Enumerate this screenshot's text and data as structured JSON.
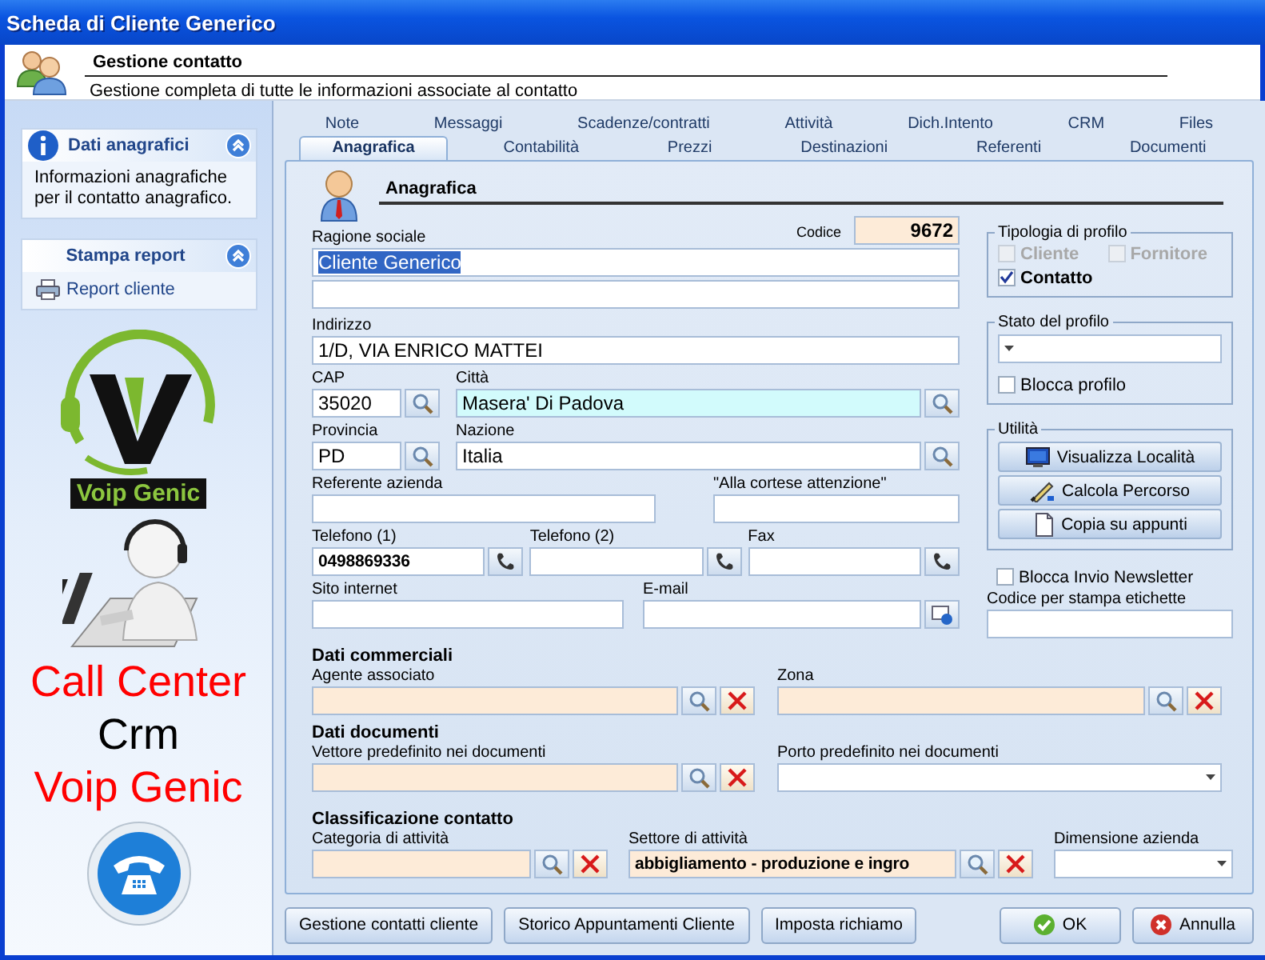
{
  "window": {
    "title": "Scheda di Cliente Generico"
  },
  "header": {
    "title": "Gestione contatto",
    "subtitle": "Gestione completa di tutte le informazioni associate al contatto"
  },
  "sidebar": {
    "panels": [
      {
        "kind": "info",
        "title": "Dati anagrafici",
        "expanded": true,
        "text": "Informazioni anagrafiche per il contatto anagrafico."
      },
      {
        "kind": "links",
        "title": "Stampa report",
        "expanded": true,
        "links": [
          "Report cliente"
        ]
      }
    ],
    "logo_caption": "Voip Genic",
    "promo_lines": [
      {
        "text": "Call Center",
        "color": "#ff0000"
      },
      {
        "text": "Crm",
        "color": "#000000"
      },
      {
        "text": "Voip Genic",
        "color": "#ff0000"
      }
    ]
  },
  "tabs": [
    [
      {
        "label": "Note",
        "selected": false
      },
      {
        "label": "Messaggi",
        "selected": false
      },
      {
        "label": "Scadenze/contratti",
        "selected": false
      },
      {
        "label": "Attività",
        "selected": false
      },
      {
        "label": "Dich.Intento",
        "selected": false
      },
      {
        "label": "CRM",
        "selected": false
      },
      {
        "label": "Files",
        "selected": false
      }
    ],
    [
      {
        "label": "Anagrafica",
        "selected": true
      },
      {
        "label": "Contabilità",
        "selected": false
      },
      {
        "label": "Prezzi",
        "selected": false
      },
      {
        "label": "Destinazioni",
        "selected": false
      },
      {
        "label": "Referenti",
        "selected": false
      },
      {
        "label": "Documenti",
        "selected": false
      }
    ]
  ],
  "section_title": "Anagrafica",
  "codice": {
    "label": "Codice",
    "value": "9672"
  },
  "ragione_sociale": {
    "label": "Ragione sociale",
    "value": "Cliente Generico",
    "value_selected": true
  },
  "rows": [
    [
      {
        "kind": "text",
        "label": "Indirizzo",
        "value": "1/D, VIA ENRICO MATTEI"
      }
    ],
    [
      {
        "kind": "lookup",
        "label": "CAP",
        "value": "35020"
      },
      {
        "kind": "lookup",
        "label": "Città",
        "value": "Masera' Di Padova",
        "focused": true
      }
    ],
    [
      {
        "kind": "lookup",
        "label": "Provincia",
        "value": "PD"
      },
      {
        "kind": "lookup",
        "label": "Nazione",
        "value": "Italia"
      }
    ],
    [
      {
        "kind": "text",
        "label": "Referente azienda"
      },
      {
        "kind": "text",
        "label": "\"Alla cortese attenzione\""
      }
    ],
    [
      {
        "kind": "dial",
        "label": "Telefono (1)",
        "value": "0498869336",
        "bold": true
      },
      {
        "kind": "dial",
        "label": "Telefono (2)"
      },
      {
        "kind": "dial",
        "label": "Fax"
      }
    ],
    [
      {
        "kind": "text",
        "label": "Sito internet"
      },
      {
        "kind": "mail",
        "label": "E-mail"
      }
    ]
  ],
  "profile_type": {
    "title": "Tipologia di profilo",
    "options": [
      {
        "label": "Cliente",
        "checked": false,
        "disabled": true
      },
      {
        "label": "Fornitore",
        "checked": false,
        "disabled": true
      },
      {
        "label": "Contatto",
        "checked": true,
        "disabled": false
      }
    ]
  },
  "profile_state": {
    "title": "Stato del profilo",
    "checkbox": {
      "label": "Blocca profilo",
      "checked": false
    }
  },
  "utilities": {
    "title": "Utilità",
    "buttons": [
      {
        "label": "Visualizza Località",
        "kind": "locate"
      },
      {
        "label": "Calcola Percorso",
        "kind": "route"
      },
      {
        "label": "Copia su appunti",
        "kind": "copy"
      }
    ]
  },
  "newsletter": {
    "label": "Blocca Invio Newsletter",
    "checked": false
  },
  "label_code": {
    "kind": "text",
    "label": "Codice per stampa etichette"
  },
  "sections": [
    {
      "title": "Dati commerciali",
      "fields": [
        {
          "kind": "lookup_clear",
          "label": "Agente associato",
          "readonly": true
        },
        {
          "kind": "lookup_clear",
          "label": "Zona",
          "readonly": true
        }
      ]
    },
    {
      "title": "Dati documenti",
      "fields": [
        {
          "kind": "lookup_clear",
          "label": "Vettore predefinito nei documenti",
          "readonly": true
        },
        {
          "kind": "dropdown",
          "label": "Porto predefinito nei documenti"
        }
      ]
    },
    {
      "title": "Classificazione contatto",
      "fields": [
        {
          "kind": "lookup_clear",
          "label": "Categoria di attività",
          "readonly": true
        },
        {
          "kind": "lookup_clear",
          "label": "Settore di attività",
          "value": "abbigliamento - produzione e ingro",
          "readonly": true,
          "bold": true
        },
        {
          "kind": "dropdown",
          "label": "Dimensione azienda"
        }
      ]
    }
  ],
  "footer": {
    "left": [
      {
        "label": "Gestione contatti cliente"
      },
      {
        "label": "Storico Appuntamenti Cliente"
      },
      {
        "label": "Imposta richiamo"
      }
    ],
    "right": [
      {
        "label": "OK",
        "kind": "confirm"
      },
      {
        "label": "Annulla",
        "kind": "cancel"
      }
    ]
  }
}
